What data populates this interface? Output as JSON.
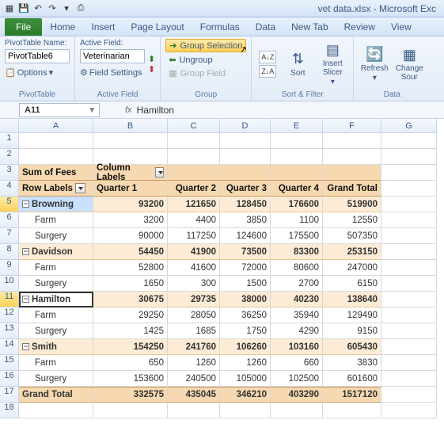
{
  "title": "vet data.xlsx - Microsoft Exc",
  "tabs": {
    "file": "File",
    "t": [
      "Home",
      "Insert",
      "Page Layout",
      "Formulas",
      "Data",
      "New Tab",
      "Review",
      "View"
    ]
  },
  "ribbon": {
    "pt_name_lbl": "PivotTable Name:",
    "pt_name": "PivotTable6",
    "options": "Options",
    "g1": "PivotTable",
    "af_lbl": "Active Field:",
    "af_val": "Veterinarian",
    "fs": "Field Settings",
    "g2": "Active Field",
    "grp_sel": "Group Selection",
    "ungroup": "Ungroup",
    "grp_field": "Group Field",
    "g3": "Group",
    "sort": "Sort",
    "slicer": "Insert Slicer",
    "g4": "Sort & Filter",
    "refresh": "Refresh",
    "change": "Change Sour",
    "g5": "Data"
  },
  "namebox": "A11",
  "formula": "Hamilton",
  "cols": [
    "",
    "A",
    "B",
    "C",
    "D",
    "E",
    "F",
    "G"
  ],
  "rows": {
    "r3": {
      "a": "Sum of Fees",
      "b": "Column Labels"
    },
    "r4": {
      "a": "Row Labels",
      "b": "Quarter 1",
      "c": "Quarter 2",
      "d": "Quarter 3",
      "e": "Quarter 4",
      "f": "Grand Total"
    },
    "r5": {
      "a": "Browning",
      "b": "93200",
      "c": "121650",
      "d": "128450",
      "e": "176600",
      "f": "519900"
    },
    "r6": {
      "a": "Farm",
      "b": "3200",
      "c": "4400",
      "d": "3850",
      "e": "1100",
      "f": "12550"
    },
    "r7": {
      "a": "Surgery",
      "b": "90000",
      "c": "117250",
      "d": "124600",
      "e": "175500",
      "f": "507350"
    },
    "r8": {
      "a": "Davidson",
      "b": "54450",
      "c": "41900",
      "d": "73500",
      "e": "83300",
      "f": "253150"
    },
    "r9": {
      "a": "Farm",
      "b": "52800",
      "c": "41600",
      "d": "72000",
      "e": "80600",
      "f": "247000"
    },
    "r10": {
      "a": "Surgery",
      "b": "1650",
      "c": "300",
      "d": "1500",
      "e": "2700",
      "f": "6150"
    },
    "r11": {
      "a": "Hamilton",
      "b": "30675",
      "c": "29735",
      "d": "38000",
      "e": "40230",
      "f": "138640"
    },
    "r12": {
      "a": "Farm",
      "b": "29250",
      "c": "28050",
      "d": "36250",
      "e": "35940",
      "f": "129490"
    },
    "r13": {
      "a": "Surgery",
      "b": "1425",
      "c": "1685",
      "d": "1750",
      "e": "4290",
      "f": "9150"
    },
    "r14": {
      "a": "Smith",
      "b": "154250",
      "c": "241760",
      "d": "106260",
      "e": "103160",
      "f": "605430"
    },
    "r15": {
      "a": "Farm",
      "b": "650",
      "c": "1260",
      "d": "1260",
      "e": "660",
      "f": "3830"
    },
    "r16": {
      "a": "Surgery",
      "b": "153600",
      "c": "240500",
      "d": "105000",
      "e": "102500",
      "f": "601600"
    },
    "r17": {
      "a": "Grand Total",
      "b": "332575",
      "c": "435045",
      "d": "346210",
      "e": "403290",
      "f": "1517120"
    }
  }
}
